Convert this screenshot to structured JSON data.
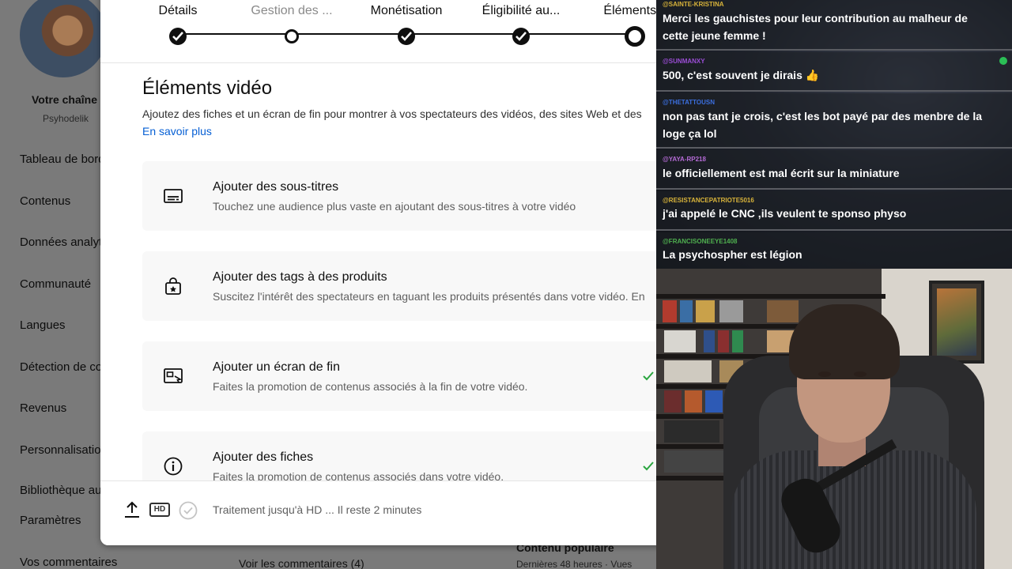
{
  "studio": {
    "channel_name": "Votre chaîne",
    "channel_handle": "Psyhodelik",
    "sidebar": [
      {
        "label": "Tableau de bord"
      },
      {
        "label": "Contenus"
      },
      {
        "label": "Données analytiques"
      },
      {
        "label": "Communauté"
      },
      {
        "label": "Langues"
      },
      {
        "label": "Détection de contenu"
      },
      {
        "label": "Revenus"
      },
      {
        "label": "Personnalisation"
      },
      {
        "label": "Bibliothèque audio"
      },
      {
        "label": "Paramètres"
      },
      {
        "label": "Vos commentaires"
      }
    ],
    "bottom": {
      "comments_link": "Voir les commentaires (4)",
      "popular_title": "Contenu populaire",
      "popular_sub": "Dernières 48 heures · Vues"
    }
  },
  "dialog": {
    "steps": [
      {
        "label": "Détails",
        "state": "done"
      },
      {
        "label": "Gestion des ...",
        "state": "pending"
      },
      {
        "label": "Monétisation",
        "state": "done"
      },
      {
        "label": "Éligibilité au...",
        "state": "done"
      },
      {
        "label": "Éléments v",
        "state": "current"
      }
    ],
    "section_title": "Éléments vidéo",
    "section_desc": "Ajoutez des fiches et un écran de fin pour montrer à vos spectateurs des vidéos, des sites Web et des",
    "learn_more": "En savoir plus",
    "cards": [
      {
        "title": "Ajouter des sous-titres",
        "subtitle": "Touchez une audience plus vaste en ajoutant des sous-titres à votre vidéo",
        "icon": "subtitles-icon",
        "done": false
      },
      {
        "title": "Ajouter des tags à des produits",
        "subtitle": "Suscitez l'intérêt des spectateurs en taguant les produits présentés dans votre vidéo. En",
        "icon": "shopping-bag-icon",
        "done": false
      },
      {
        "title": "Ajouter un écran de fin",
        "subtitle": "Faites la promotion de contenus associés à la fin de votre vidéo.",
        "icon": "end-screen-icon",
        "done": true
      },
      {
        "title": "Ajouter des fiches",
        "subtitle": "Faites la promotion de contenus associés dans votre vidéo.",
        "icon": "info-icon",
        "done": true
      }
    ],
    "footer": {
      "hd_badge": "HD",
      "processing": "Traitement jusqu'à HD ... Il reste 2 minutes"
    }
  },
  "chat": {
    "messages": [
      {
        "user": "@SAINTE-KRISTINA",
        "color": "#d9b43a",
        "text": "Merci les gauchistes pour leur contribution au malheur de cette jeune femme !"
      },
      {
        "user": "@SUNMANXY",
        "color": "#9b4dd6",
        "text": "500, c'est souvent je dirais 👍"
      },
      {
        "user": "@THETATTOUSN",
        "color": "#3b6fe0",
        "text": "non pas tant je crois, c'est les bot payé par des menbre de la loge ça lol"
      },
      {
        "user": "@YAYA-RP218",
        "color": "#b56bd6",
        "text": "le officiellement est mal écrit sur la miniature"
      },
      {
        "user": "@RESISTANCEPATRIOTE5016",
        "color": "#d9b43a",
        "text": "j'ai appelé le CNC ,ils veulent te sponso physo"
      },
      {
        "user": "@FRANCISONEEYE1408",
        "color": "#4fb04f",
        "text": "La psychospher est légion"
      }
    ]
  },
  "colors": {
    "link": "#065fd4",
    "dark": "#0f0f0f",
    "check_green": "#2ba640"
  }
}
